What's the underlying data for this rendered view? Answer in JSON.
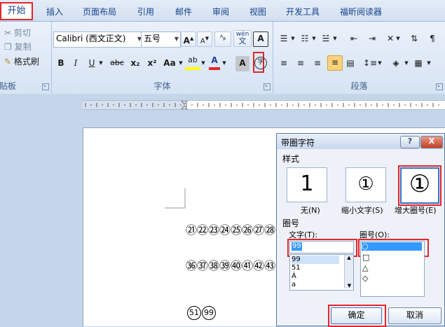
{
  "tabs": [
    "开始",
    "插入",
    "页面布局",
    "引用",
    "邮件",
    "审阅",
    "视图",
    "开发工具",
    "福昕阅读器"
  ],
  "clipboard": {
    "cut": "剪切",
    "copy": "复制",
    "format_painter": "格式刷",
    "label": "贴板"
  },
  "font": {
    "name": "Calibri (西文正文)",
    "size": "五号",
    "label": "字体",
    "grow": "A",
    "shrink": "A",
    "phonetic": "wén",
    "border_char": "A",
    "bold": "B",
    "italic": "I",
    "underline": "U",
    "strike": "abc",
    "sub": "x₂",
    "sup": "x²",
    "case": "Aa",
    "highlight": "ab",
    "color_a": "A",
    "shade_a": "A",
    "enclose": "字"
  },
  "paragraph": {
    "label": "段落"
  },
  "document": {
    "line1": [
      "㉑",
      "㉒",
      "㉓",
      "㉔",
      "㉕",
      "㉖",
      "㉗",
      "㉘"
    ],
    "line2": [
      "㊱",
      "㊲",
      "㊳",
      "㊴",
      "㊵",
      "㊶",
      "㊷",
      "㊸"
    ],
    "line3": [
      "51",
      "99"
    ]
  },
  "dialog": {
    "title": "带圈字符",
    "help": "?",
    "close": "X",
    "style_label": "样式",
    "styles": [
      {
        "label": "无(N)",
        "glyph": "1"
      },
      {
        "label": "缩小文字(S)",
        "glyph": "①"
      },
      {
        "label": "增大圈号(E)",
        "glyph": "①"
      }
    ],
    "enclosure_label": "圈号",
    "text_label": "文字(T):",
    "text_value": "99",
    "text_options": [
      "99",
      "51",
      "À",
      "a"
    ],
    "enclose_label": "圈号(O):",
    "enclose_options": [
      "○",
      "□",
      "△",
      "◇"
    ],
    "ok": "确定",
    "cancel": "取消"
  },
  "colors": {
    "accent_red": "#e3262b",
    "highlight_yellow": "#ffff00",
    "font_red": "#e3262b",
    "selection": "#3399ff"
  }
}
